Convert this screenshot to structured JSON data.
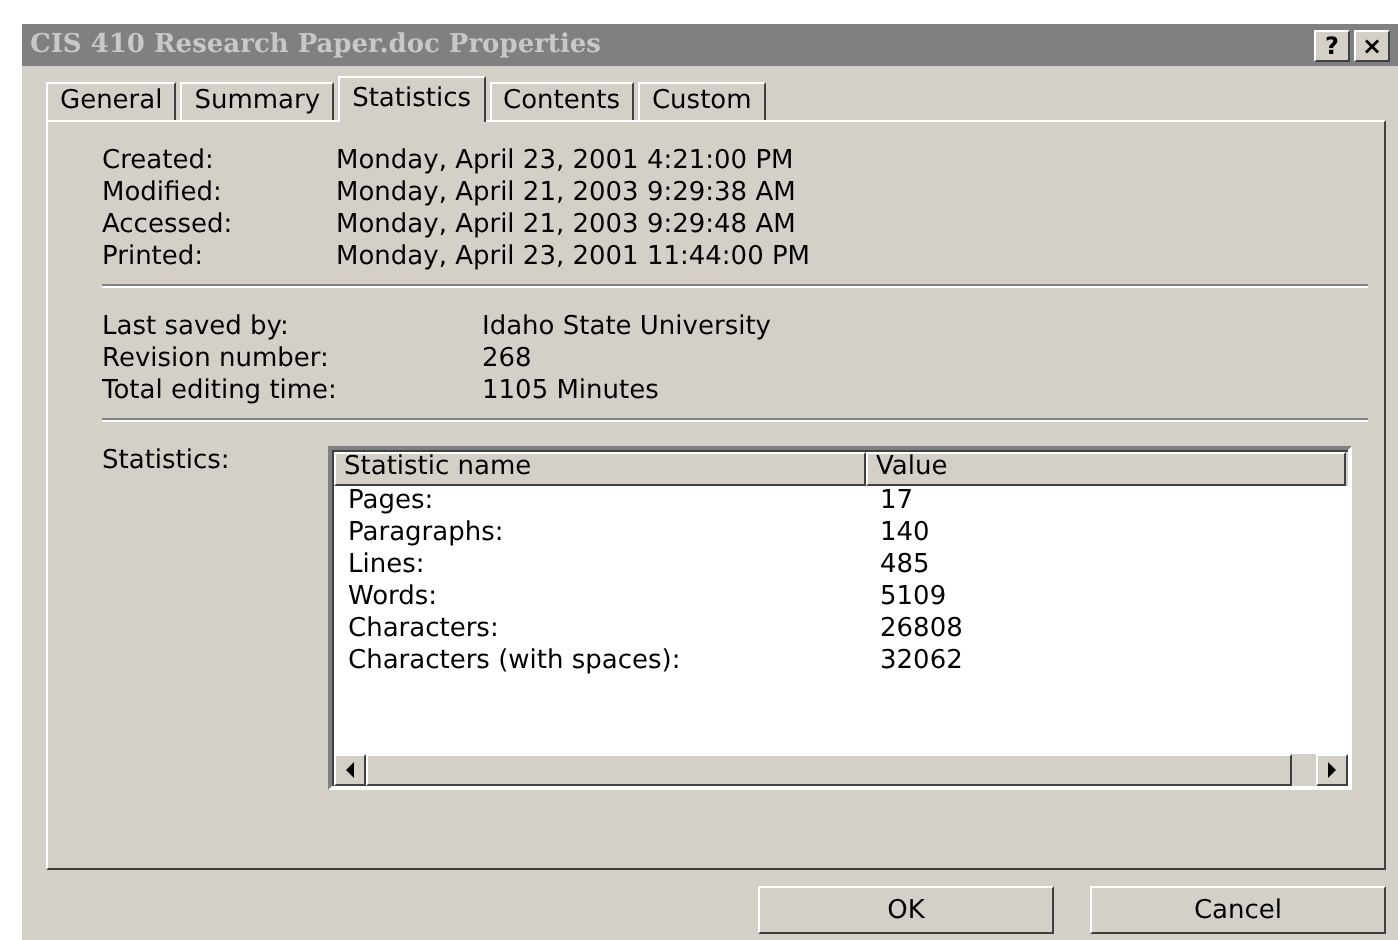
{
  "window": {
    "title": "CIS 410 Research Paper.doc Properties",
    "help_button": "?",
    "close_button": "×"
  },
  "tabs": [
    {
      "label": "General",
      "selected": false
    },
    {
      "label": "Summary",
      "selected": false
    },
    {
      "label": "Statistics",
      "selected": true
    },
    {
      "label": "Contents",
      "selected": false
    },
    {
      "label": "Custom",
      "selected": false
    }
  ],
  "dates": [
    {
      "label": "Created:",
      "value": "Monday, April 23, 2001 4:21:00 PM"
    },
    {
      "label": "Modified:",
      "value": "Monday, April 21, 2003 9:29:38 AM"
    },
    {
      "label": "Accessed:",
      "value": "Monday, April 21, 2003 9:29:48 AM"
    },
    {
      "label": "Printed:",
      "value": "Monday, April 23, 2001 11:44:00 PM"
    }
  ],
  "info": [
    {
      "label": "Last saved by:",
      "value": "Idaho State University"
    },
    {
      "label": "Revision number:",
      "value": "268"
    },
    {
      "label": "Total editing time:",
      "value": "1105 Minutes"
    }
  ],
  "statistics": {
    "label": "Statistics:",
    "columns": [
      "Statistic name",
      "Value"
    ],
    "rows": [
      [
        "Pages:",
        "17"
      ],
      [
        "Paragraphs:",
        "140"
      ],
      [
        "Lines:",
        "485"
      ],
      [
        "Words:",
        "5109"
      ],
      [
        "Characters:",
        "26808"
      ],
      [
        "Characters (with spaces):",
        "32062"
      ]
    ]
  },
  "buttons": [
    "OK",
    "Cancel"
  ]
}
